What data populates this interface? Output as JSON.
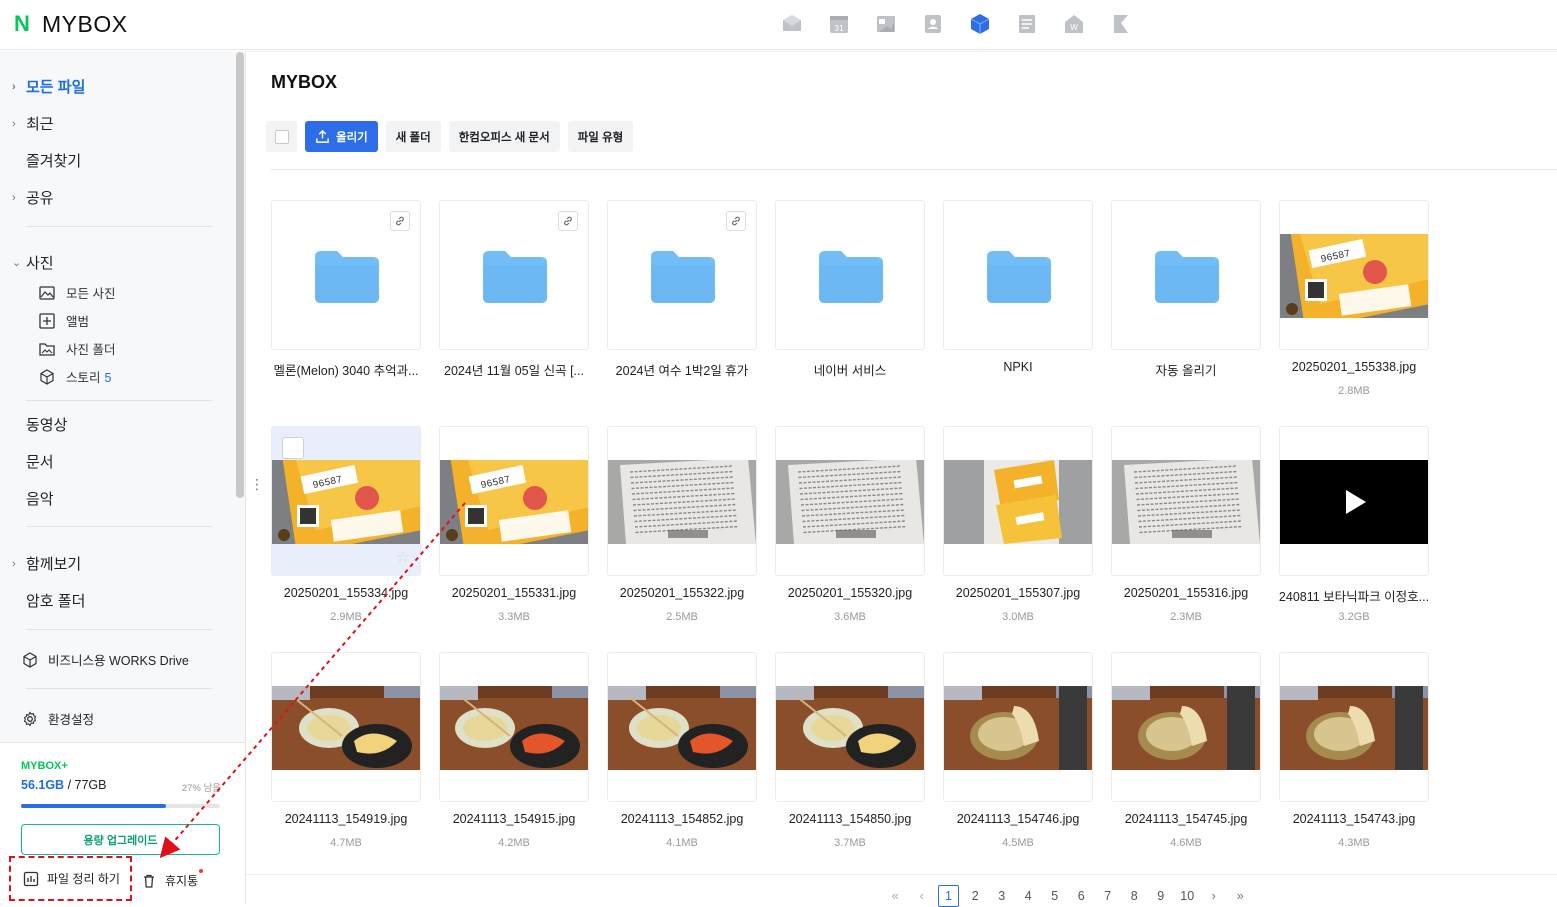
{
  "app": {
    "logo_letter": "N",
    "title": "MYBOX"
  },
  "top_apps": [
    {
      "icon": "mail-icon"
    },
    {
      "icon": "calendar-icon",
      "text": "31"
    },
    {
      "icon": "news-icon"
    },
    {
      "icon": "contacts-icon"
    },
    {
      "icon": "mybox-icon",
      "active": true
    },
    {
      "icon": "memo-icon"
    },
    {
      "icon": "pay-icon"
    },
    {
      "icon": "bookmark-icon"
    }
  ],
  "sidebar": {
    "nav": [
      {
        "label": "모든 파일",
        "chevron": "›",
        "active": true
      },
      {
        "label": "최근",
        "chevron": "›"
      },
      {
        "label": "즐겨찾기",
        "chevron": ""
      },
      {
        "label": "공유",
        "chevron": "›"
      },
      {
        "label": "사진",
        "chevron": "⌄"
      }
    ],
    "photo_sub": [
      {
        "label": "모든 사진",
        "icon": "image-icon"
      },
      {
        "label": "앨범",
        "icon": "album-icon"
      },
      {
        "label": "사진 폴더",
        "icon": "photo-folder-icon"
      },
      {
        "label": "스토리",
        "icon": "cube-icon",
        "count": "5"
      }
    ],
    "nav2": [
      {
        "label": "동영상"
      },
      {
        "label": "문서"
      },
      {
        "label": "음악"
      }
    ],
    "nav3": [
      {
        "label": "함께보기",
        "chevron": "›"
      },
      {
        "label": "암호 폴더",
        "chevron": ""
      }
    ],
    "business_drive": "비즈니스용 WORKS Drive",
    "settings": "환경설정",
    "storage": {
      "plan": "MYBOX+",
      "used": "56.1GB",
      "total": " / 77GB",
      "remain": "27% 남음",
      "used_fraction": 0.73
    },
    "upgrade_label": "용량 업그레이드",
    "organize_label": "파일 정리 하기",
    "trash_label": "휴지통"
  },
  "main": {
    "title": "MYBOX",
    "toolbar": {
      "upload": "올리기",
      "new_folder": "새 폴더",
      "hancom": "한컴오피스 새 문서",
      "file_type": "파일 유형"
    },
    "files": [
      {
        "name": "멜론(Melon) 3040 추억과...",
        "type": "folder",
        "shared": true
      },
      {
        "name": "2024년 11월 05일 신곡 [...",
        "type": "folder",
        "shared": true
      },
      {
        "name": "2024년 여수 1박2일 휴가",
        "type": "folder",
        "shared": true
      },
      {
        "name": "네이버 서비스",
        "type": "folder"
      },
      {
        "name": "NPKI",
        "type": "folder"
      },
      {
        "name": "자동 올리기",
        "type": "folder"
      },
      {
        "name": "20250201_155338.jpg",
        "size": "2.8MB",
        "type": "photo",
        "style": "ticket"
      },
      {
        "name": "20250201_155334.jpg",
        "size": "2.9MB",
        "type": "photo",
        "style": "ticket",
        "selected": true
      },
      {
        "name": "20250201_155331.jpg",
        "size": "3.3MB",
        "type": "photo",
        "style": "ticket"
      },
      {
        "name": "20250201_155322.jpg",
        "size": "2.5MB",
        "type": "photo",
        "style": "paper"
      },
      {
        "name": "20250201_155320.jpg",
        "size": "3.6MB",
        "type": "photo",
        "style": "paper"
      },
      {
        "name": "20250201_155307.jpg",
        "size": "3.0MB",
        "type": "photo",
        "style": "ticketpaper"
      },
      {
        "name": "20250201_155316.jpg",
        "size": "2.3MB",
        "type": "photo",
        "style": "paper"
      },
      {
        "name": "240811 보타닉파크 이정호...",
        "size": "3.2GB",
        "type": "video"
      },
      {
        "name": "20241113_154919.jpg",
        "size": "4.7MB",
        "type": "photo",
        "style": "food"
      },
      {
        "name": "20241113_154915.jpg",
        "size": "4.2MB",
        "type": "photo",
        "style": "food"
      },
      {
        "name": "20241113_154852.jpg",
        "size": "4.1MB",
        "type": "photo",
        "style": "food"
      },
      {
        "name": "20241113_154850.jpg",
        "size": "3.7MB",
        "type": "photo",
        "style": "food"
      },
      {
        "name": "20241113_154746.jpg",
        "size": "4.5MB",
        "type": "photo",
        "style": "food2"
      },
      {
        "name": "20241113_154745.jpg",
        "size": "4.6MB",
        "type": "photo",
        "style": "food2"
      },
      {
        "name": "20241113_154743.jpg",
        "size": "4.3MB",
        "type": "photo",
        "style": "food2"
      }
    ]
  },
  "pagination": {
    "first": "«",
    "prev": "‹",
    "pages": [
      "1",
      "2",
      "3",
      "4",
      "5",
      "6",
      "7",
      "8",
      "9",
      "10"
    ],
    "current": "1",
    "next": "›",
    "last": "»"
  }
}
